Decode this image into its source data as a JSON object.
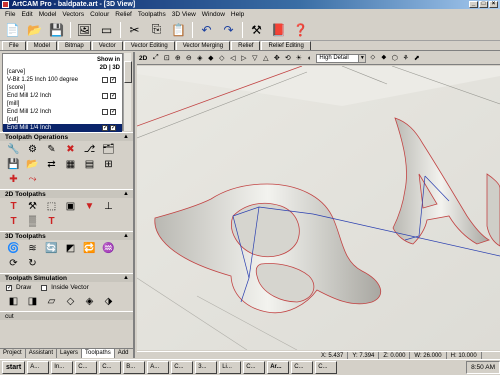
{
  "window": {
    "title": "ArtCAM Pro - baldpate.art - [3D View]"
  },
  "menu": [
    "File",
    "Edit",
    "Model",
    "Vectors",
    "Colour",
    "Relief",
    "Toolpaths",
    "3D View",
    "Window",
    "Help"
  ],
  "tabs": [
    "File",
    "Model",
    "Bitmap",
    "Vector",
    "Vector Editing",
    "Vector Merging",
    "Relief",
    "Relief Editing"
  ],
  "toolpath_list": {
    "show_in_label": "Show in",
    "show_in_modes": "2D | 3D",
    "rows": [
      {
        "text": "[carve]",
        "selected": false
      },
      {
        "text": "V-Bit 1.25 Inch 100 degree",
        "selected": false
      },
      {
        "text": "[score]",
        "selected": false
      },
      {
        "text": "End Mill 1/2 Inch",
        "selected": false
      },
      {
        "text": "[mill]",
        "selected": false
      },
      {
        "text": "End Mill 1/2 Inch",
        "selected": false
      },
      {
        "text": "[cut]",
        "selected": false
      },
      {
        "text": "End Mill 1/4 Inch",
        "selected": true
      }
    ]
  },
  "sections": {
    "toolpath_operations": "Toolpath Operations",
    "toolpaths_2d": "2D Toolpaths",
    "toolpaths_3d": "3D Toolpaths",
    "toolpath_simulation": "Toolpath Simulation",
    "cut": "cut"
  },
  "simulation": {
    "draw_label": "Draw",
    "inside_vector_label": "Inside Vector"
  },
  "bottom_tabs": [
    "Project",
    "Assistant",
    "Layers",
    "Toolpaths",
    "Add In"
  ],
  "viewbar": {
    "mode": "2D",
    "detail": "High Detail"
  },
  "status": {
    "x": "X: 5.437",
    "y": "Y: 7.394",
    "z": "Z: 0.000",
    "w": "W: 26.000",
    "h": "H: 10.000"
  },
  "taskbar": {
    "start": "start",
    "tasks": [
      "A...",
      "In...",
      "C...",
      "C...",
      "B...",
      "A...",
      "C...",
      "3...",
      "Li...",
      "C...",
      "Ar...",
      "C...",
      "C..."
    ],
    "clock": "8:50 AM"
  },
  "colors": {
    "toolpath_red": "#cc2222",
    "vector_blue": "#2a3fb0",
    "selection": "#0a246a"
  }
}
